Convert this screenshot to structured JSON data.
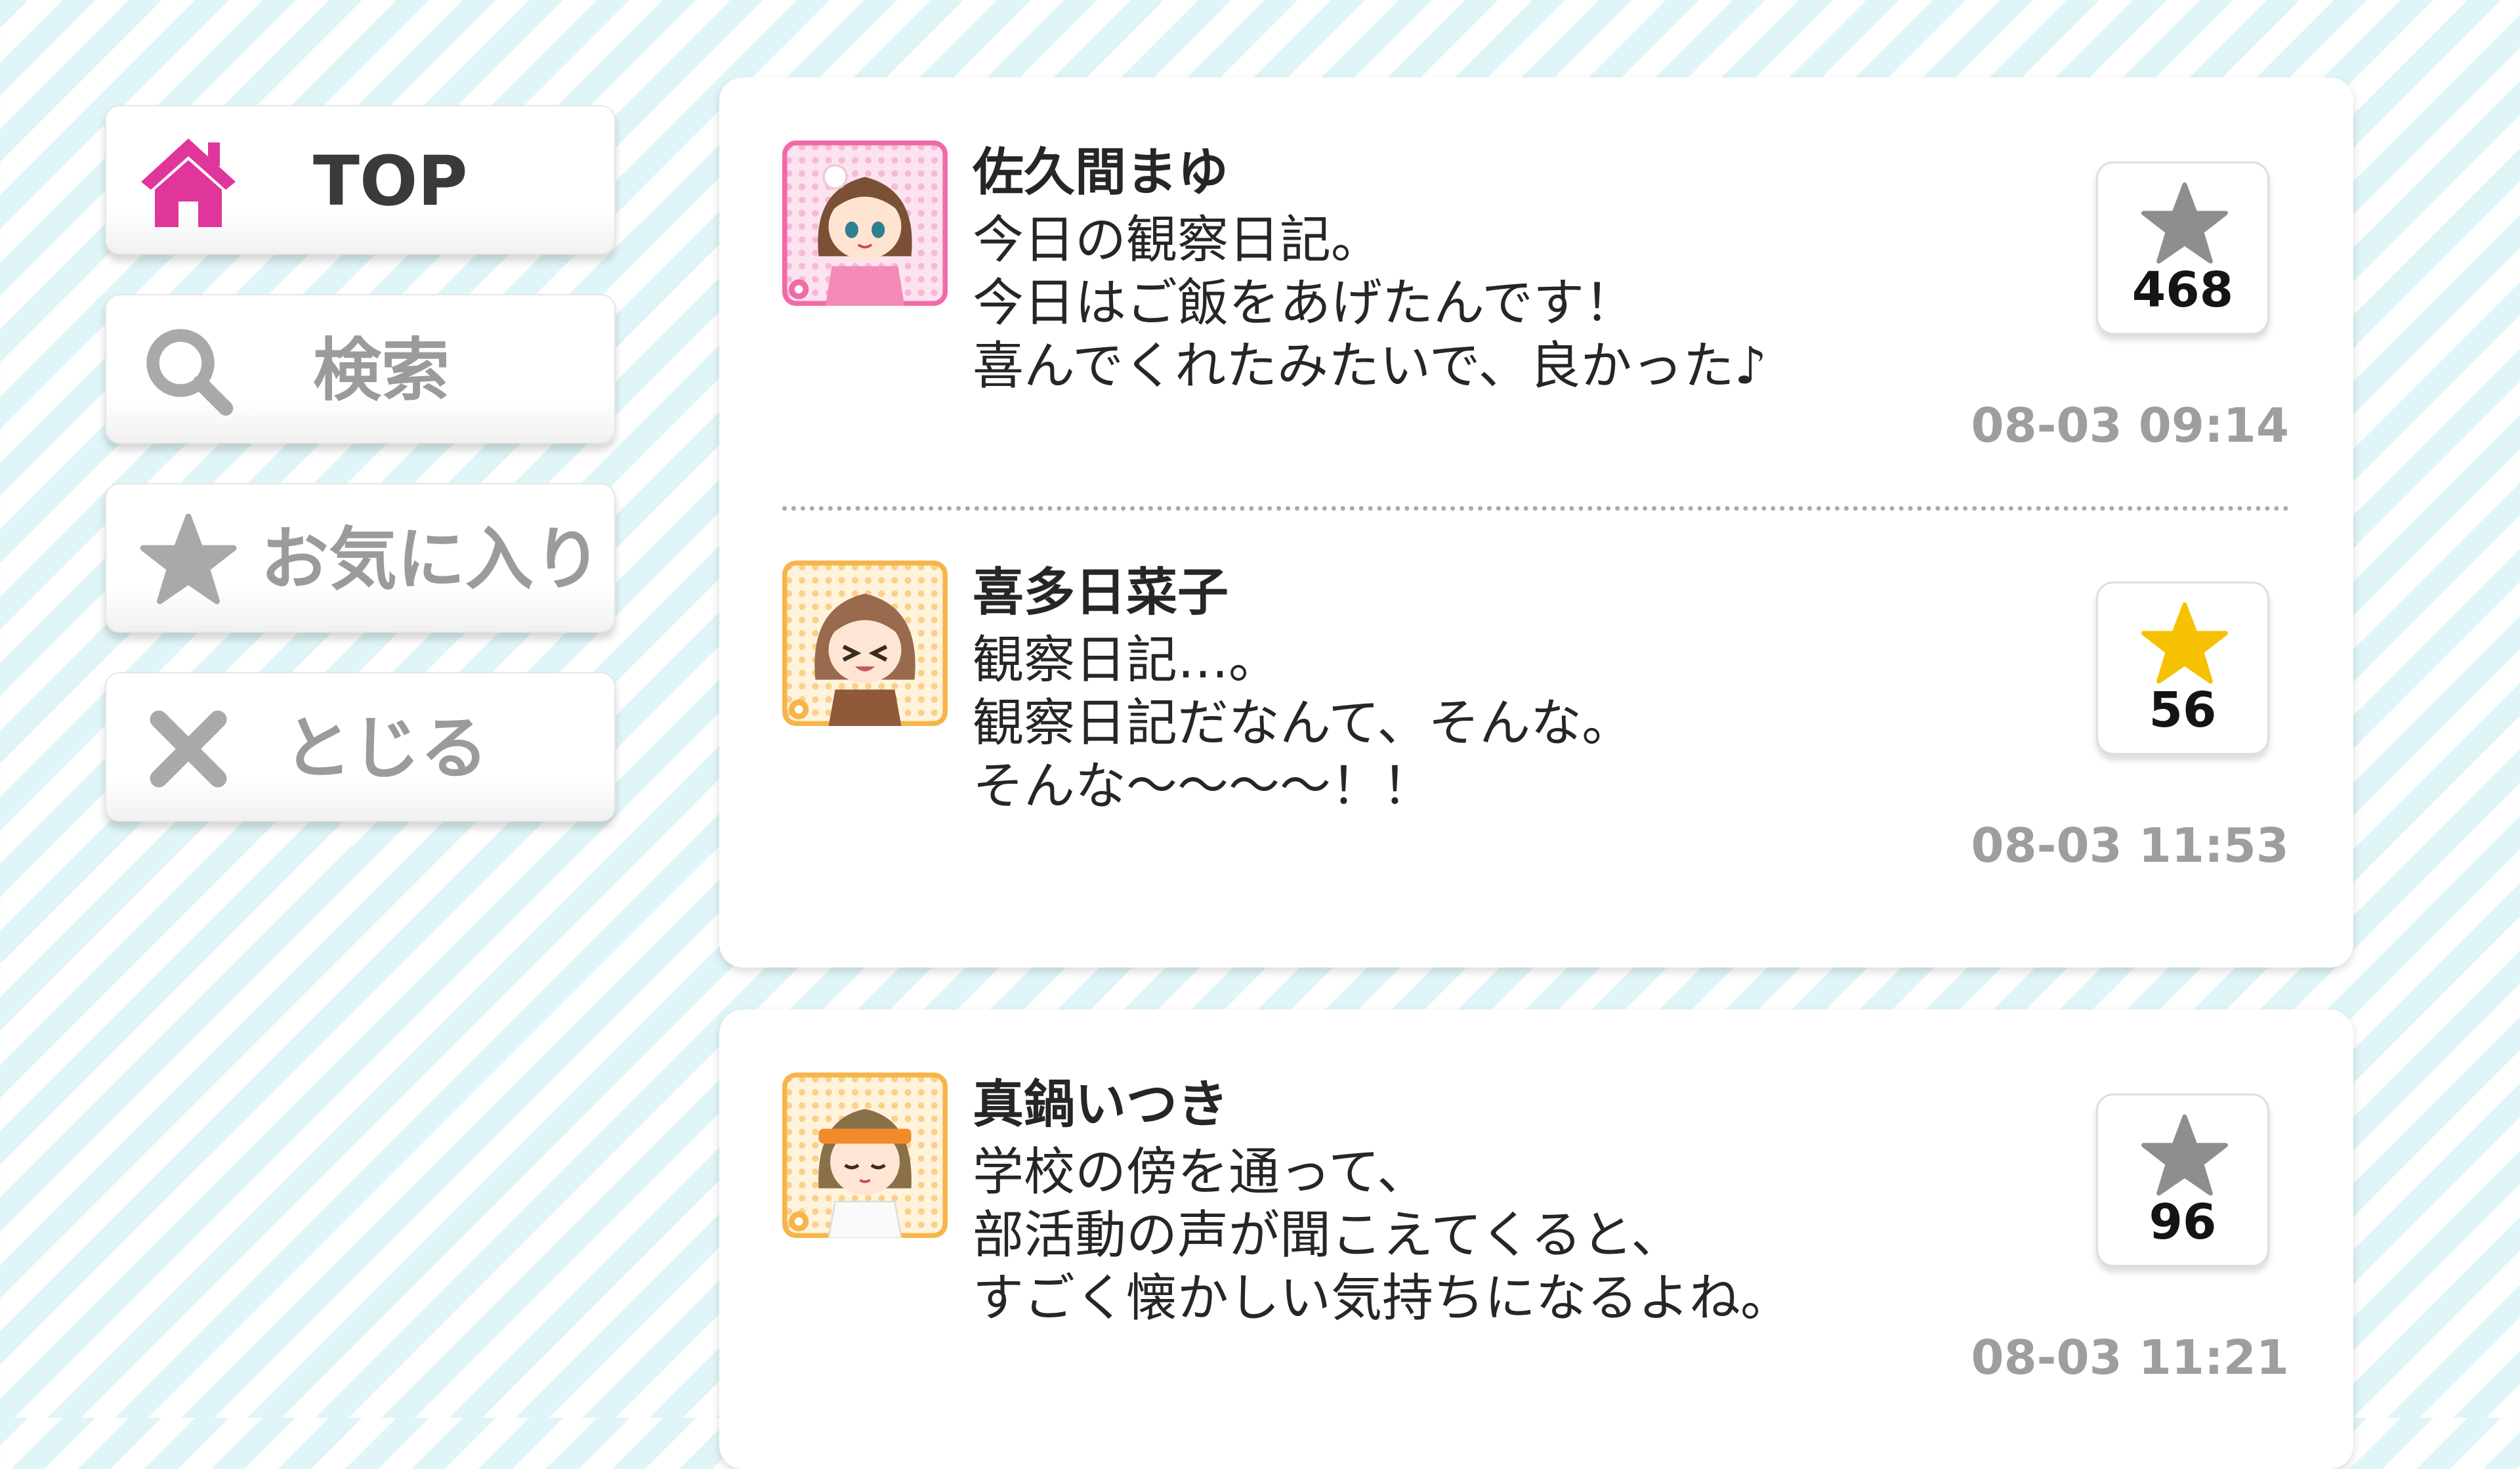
{
  "colors": {
    "accent_pink": "#e0359b",
    "star_gray": "#8e8e8e",
    "star_gold": "#f6c100",
    "stripe": "#dff5f7",
    "text_dark": "#262626",
    "text_muted": "#9e9e9e"
  },
  "sidebar": {
    "items": [
      {
        "label": "TOP",
        "icon": "home-icon",
        "active": true
      },
      {
        "label": "検索",
        "icon": "search-icon",
        "active": false
      },
      {
        "label": "お気に入り",
        "icon": "star-icon",
        "active": false
      },
      {
        "label": "とじる",
        "icon": "close-icon",
        "active": false
      }
    ]
  },
  "posts": [
    {
      "name": "佐久間まゆ",
      "avatar": "mayu-avatar",
      "lines": [
        "今日の観察日記。",
        "今日はご飯をあげたんです！",
        "喜んでくれたみたいで、良かった♪"
      ],
      "timestamp": "08-03 09:14",
      "favorites": "468",
      "favorited": false
    },
    {
      "name": "喜多日菜子",
      "avatar": "hinako-avatar",
      "lines": [
        "観察日記…。",
        "観察日記だなんて、そんな。",
        "そんな〜〜〜〜！！"
      ],
      "timestamp": "08-03 11:53",
      "favorites": "56",
      "favorited": true
    },
    {
      "name": "真鍋いつき",
      "avatar": "itsuki-avatar",
      "lines": [
        "学校の傍を通って、",
        "部活動の声が聞こえてくると、",
        "すごく懐かしい気持ちになるよね。"
      ],
      "timestamp": "08-03 11:21",
      "favorites": "96",
      "favorited": false
    }
  ]
}
